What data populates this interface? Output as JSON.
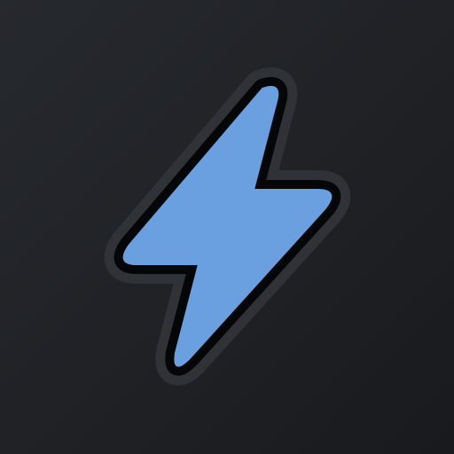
{
  "icon": {
    "name": "lightning-bolt",
    "colors": {
      "background_top": "#26292e",
      "background_bottom": "#181a1d",
      "bolt_fill": "#6a9fe0",
      "bolt_outline": "#050607",
      "bolt_halo": "#2f3237"
    }
  }
}
